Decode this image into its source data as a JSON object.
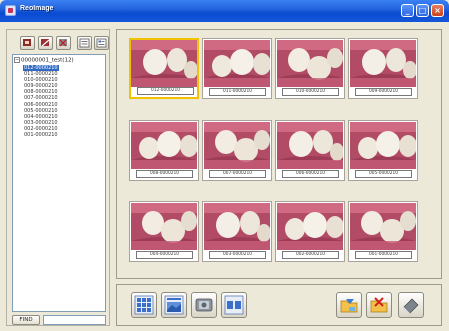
{
  "window": {
    "title": "ReoImage",
    "min_glyph": "_",
    "max_glyph": "□",
    "close_glyph": "×"
  },
  "sidebar": {
    "tools": [
      {
        "icon": "add-patient-icon"
      },
      {
        "icon": "edit-patient-icon"
      },
      {
        "icon": "delete-patient-icon"
      },
      {
        "icon": "list-view-icon"
      },
      {
        "icon": "detail-view-icon"
      }
    ],
    "tree": {
      "root_label": "00000001_test(12)",
      "items": [
        "012-0000210",
        "011-0000210",
        "010-0000210",
        "009-0000210",
        "008-0000210",
        "007-0000210",
        "006-0000210",
        "005-0000210",
        "004-0000210",
        "003-0000210",
        "002-0000210",
        "001-0000210"
      ],
      "selected_index": 0
    },
    "find": {
      "label": "FIND",
      "value": ""
    }
  },
  "gallery": {
    "thumbnails": [
      {
        "caption": "012-0000210",
        "selected": true
      },
      {
        "caption": "011-0000210"
      },
      {
        "caption": "010-0000210"
      },
      {
        "caption": "009-0000210"
      },
      {
        "caption": "008-0000210"
      },
      {
        "caption": "007-0000210"
      },
      {
        "caption": "006-0000210"
      },
      {
        "caption": "005-0000210"
      },
      {
        "caption": "004-0000210"
      },
      {
        "caption": "003-0000210"
      },
      {
        "caption": "002-0000210"
      },
      {
        "caption": "001-0000210"
      }
    ]
  },
  "toolbar": {
    "left_buttons": [
      {
        "icon": "grid-view-icon"
      },
      {
        "icon": "single-view-icon"
      },
      {
        "icon": "capture-device-icon"
      },
      {
        "icon": "compare-view-icon"
      }
    ],
    "right_buttons": [
      {
        "icon": "import-folder-icon"
      },
      {
        "icon": "delete-folder-icon"
      },
      {
        "icon": "eraser-icon"
      }
    ]
  },
  "colors": {
    "selection": "#316AC5",
    "thumb_highlight": "#F2C200",
    "titlebar": "#0A4BD0"
  }
}
